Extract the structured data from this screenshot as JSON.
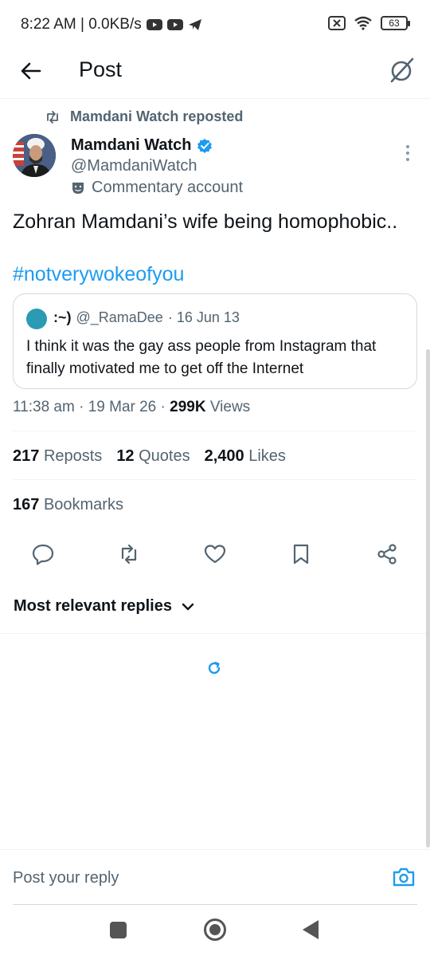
{
  "status_bar": {
    "time_speed": "8:22 AM | 0.0KB/s",
    "battery": "63",
    "icons": [
      "youtube-icon",
      "youtube-icon",
      "telegram-icon",
      "sim-off-icon",
      "wifi-icon",
      "battery-icon"
    ]
  },
  "header": {
    "title": "Post",
    "back_icon": "arrow-left-icon",
    "grok_icon": "grok-icon"
  },
  "repost": {
    "label": "Mamdani Watch reposted"
  },
  "author": {
    "name": "Mamdani Watch",
    "handle": "@MamdaniWatch",
    "verified": true,
    "badge_label": "Commentary account"
  },
  "post": {
    "text": "Zohran Mamdani’s wife being homophobic..",
    "hashtag": "#notverywokeofyou"
  },
  "quote": {
    "name": ":~)",
    "handle": "@_RamaDee",
    "date": "· 16 Jun 13",
    "text": "I think it was the gay ass people from Instagram that finally motivated me to get off the Internet"
  },
  "meta": {
    "time": "11:38 am",
    "date": "19 Mar 26",
    "views_count": "299K",
    "views_label": "Views"
  },
  "stats": {
    "reposts_count": "217",
    "reposts_label": "Reposts",
    "quotes_count": "12",
    "quotes_label": "Quotes",
    "likes_count": "2,400",
    "likes_label": "Likes",
    "bookmarks_count": "167",
    "bookmarks_label": "Bookmarks"
  },
  "replies": {
    "sort_label": "Most relevant replies"
  },
  "composer": {
    "placeholder": "Post your reply"
  },
  "colors": {
    "accent": "#1d9bf0",
    "text_primary": "#0f1419",
    "text_secondary": "#536471",
    "border": "#eff3f4"
  }
}
